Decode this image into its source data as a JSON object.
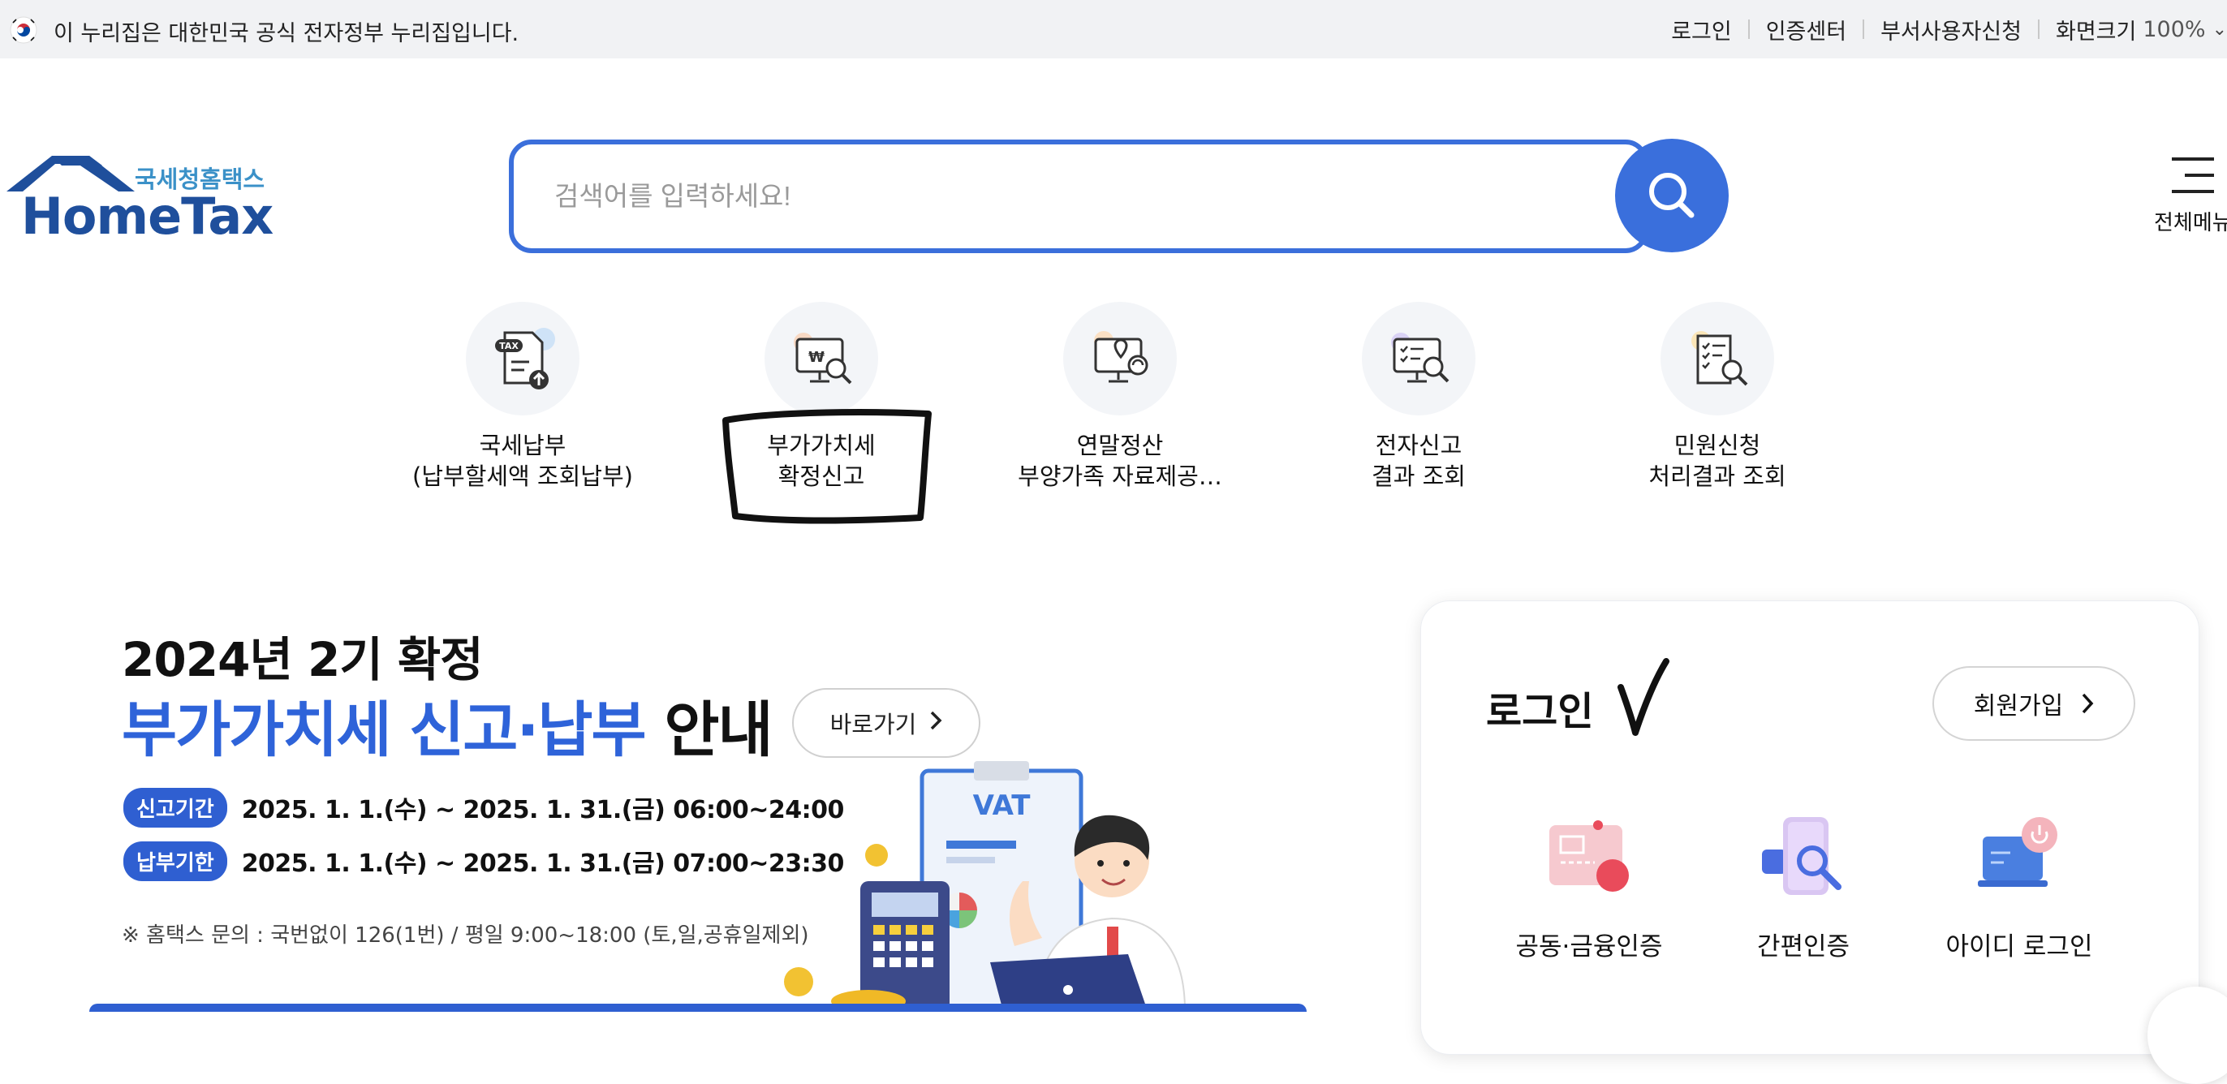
{
  "gov_bar": {
    "notice": "이 누리집은 대한민국 공식 전자정부 누리집입니다.",
    "links": [
      "로그인",
      "인증센터",
      "부서사용자신청"
    ],
    "zoom_label": "화면크기",
    "zoom_value": "100%"
  },
  "header": {
    "logo_sub": "국세청홈택스",
    "logo_main": "HomeTax",
    "search_placeholder": "검색어를 입력하세요!",
    "all_menu_label": "전체메뉴"
  },
  "quick_menu": [
    {
      "line1": "국세납부",
      "line2": "(납부할세액 조회납부)",
      "icon": "tax-document-upload-icon"
    },
    {
      "line1": "부가가치세",
      "line2": "확정신고",
      "icon": "won-monitor-search-icon"
    },
    {
      "line1": "연말정산",
      "line2": "부양가족 자료제공…",
      "icon": "location-monitor-icon"
    },
    {
      "line1": "전자신고",
      "line2": "결과 조회",
      "icon": "checklist-monitor-search-icon"
    },
    {
      "line1": "민원신청",
      "line2": "처리결과 조회",
      "icon": "checklist-document-search-icon"
    }
  ],
  "banner": {
    "title1": "2024년 2기 확정",
    "title2_blue": "부가가치세 신고·납부",
    "title2_dark": "안내",
    "go_button": "바로가기",
    "rows": [
      {
        "badge": "신고기간",
        "dates": "2025. 1. 1.(수) ~ 2025. 1. 31.(금) 06:00~24:00"
      },
      {
        "badge": "납부기한",
        "dates": "2025. 1. 1.(수) ~ 2025. 1. 31.(금) 07:00~23:30"
      }
    ],
    "note": "※ 홈택스 문의 : 국번없이 126(1번) / 평일 9:00~18:00 (토,일,공휴일제외)",
    "vat_label": "VAT"
  },
  "login": {
    "title": "로그인",
    "join_button": "회원가입",
    "options": [
      {
        "label": "공동·금융인증",
        "icon": "certificate-card-icon"
      },
      {
        "label": "간편인증",
        "icon": "phone-search-icon"
      },
      {
        "label": "아이디 로그인",
        "icon": "laptop-power-icon"
      }
    ]
  },
  "colors": {
    "brand_blue": "#3a6fdc",
    "logo_navy": "#1f4f9c",
    "banner_blue": "#2e63d9"
  }
}
